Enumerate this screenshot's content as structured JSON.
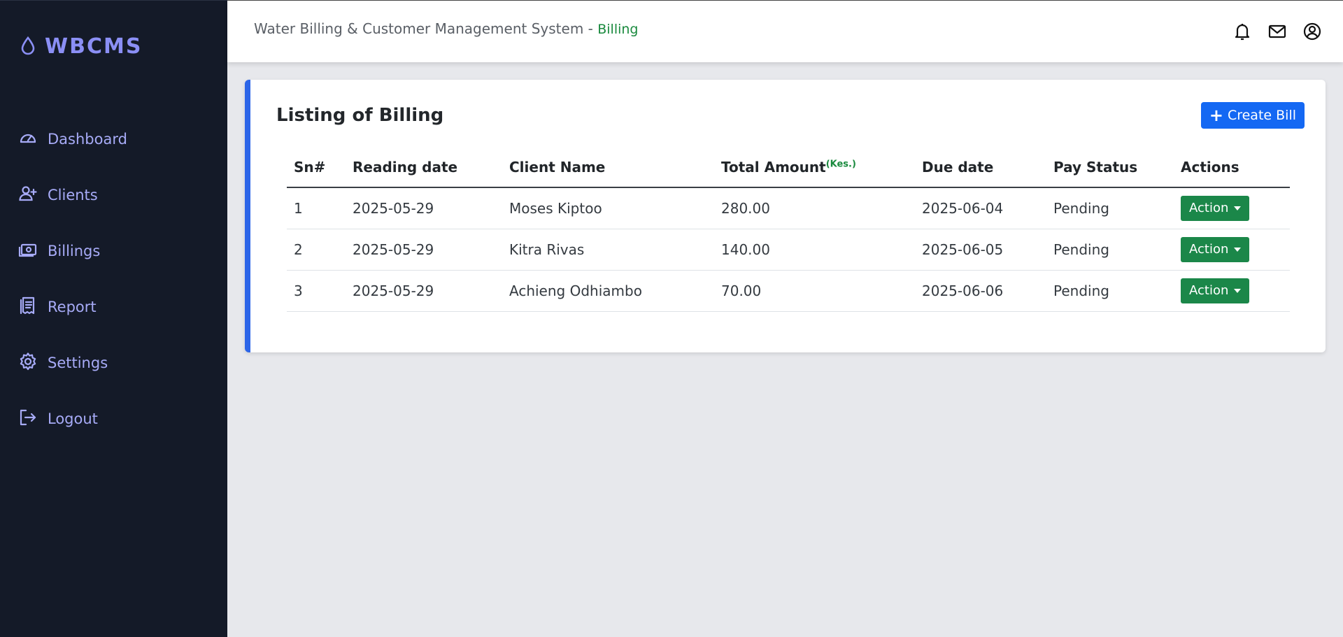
{
  "brand": {
    "name": "WBCMS"
  },
  "sidebar": {
    "items": [
      {
        "label": "Dashboard",
        "icon": "gauge-icon"
      },
      {
        "label": "Clients",
        "icon": "user-plus-icon"
      },
      {
        "label": "Billings",
        "icon": "money-icon"
      },
      {
        "label": "Report",
        "icon": "receipt-icon"
      },
      {
        "label": "Settings",
        "icon": "gear-icon"
      },
      {
        "label": "Logout",
        "icon": "logout-icon"
      }
    ]
  },
  "topbar": {
    "title": "Water Billing & Customer Management System -",
    "page": "Billing",
    "icons": [
      "bell-icon",
      "envelope-icon",
      "user-circle-icon"
    ]
  },
  "card": {
    "title": "Listing of Billing",
    "create_label": "Create Bill"
  },
  "table": {
    "headers": [
      "Sn#",
      "Reading date",
      "Client Name",
      "Total Amount",
      "Due date",
      "Pay Status",
      "Actions"
    ],
    "amount_unit": "(Kes.)",
    "rows": [
      {
        "sn": "1",
        "reading_date": "2025-05-29",
        "client": "Moses Kiptoo",
        "amount": "280.00",
        "due": "2025-06-04",
        "status": "Pending",
        "action": "Action"
      },
      {
        "sn": "2",
        "reading_date": "2025-05-29",
        "client": "Kitra Rivas",
        "amount": "140.00",
        "due": "2025-06-05",
        "status": "Pending",
        "action": "Action"
      },
      {
        "sn": "3",
        "reading_date": "2025-05-29",
        "client": "Achieng Odhiambo",
        "amount": "70.00",
        "due": "2025-06-06",
        "status": "Pending",
        "action": "Action"
      }
    ]
  },
  "colors": {
    "sidebar_bg": "#141a28",
    "accent": "#8b8ff5",
    "primary": "#1468f3",
    "success": "#1b8749",
    "card_border": "#2c65e8"
  }
}
